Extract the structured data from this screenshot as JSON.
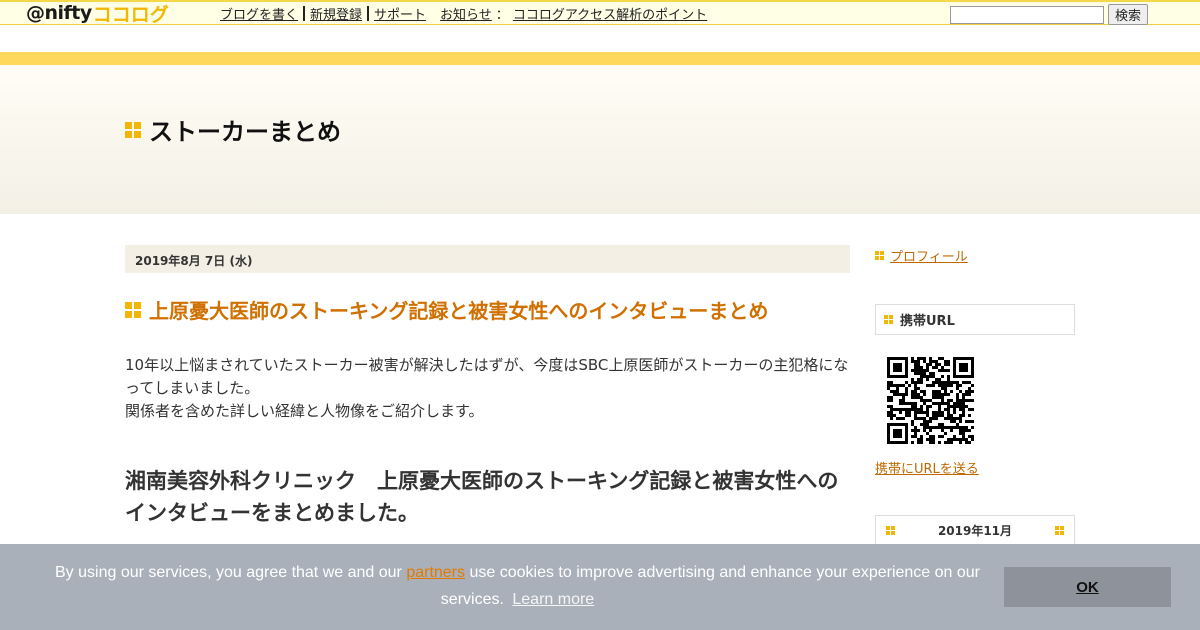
{
  "topbar": {
    "logo_at": "@nifty",
    "logo_cocolog": "ココログ",
    "nav": [
      {
        "label": "ブログを書く"
      },
      {
        "label": "新規登録"
      },
      {
        "label": "サポート"
      }
    ],
    "notice_label": "お知らせ",
    "colon": "：",
    "notice_link": "ココログアクセス解析のポイント",
    "search_button": "検索",
    "search_value": ""
  },
  "header": {
    "blog_title": "ストーカーまとめ"
  },
  "entry": {
    "date": "2019年8月 7日 (水)",
    "title": "上原憂大医師のストーキング記録と被害女性へのインタビューまとめ",
    "body_line1": "10年以上悩まされていたストーカー被害が解決したはずが、今度はSBC上原医師がストーカーの主犯格になってしまいました。",
    "body_line2": "関係者を含めた詳しい経緯と人物像をご紹介します。",
    "heading": "湘南美容外科クリニック　上原憂大医師のストーキング記録と被害女性へのインタビューをまとめました。"
  },
  "sidebar": {
    "profile_link": "プロフィール",
    "mobile_url_title": "携帯URL",
    "mobile_link": "携帯にURLを送る",
    "calendar_title": "2019年11月"
  },
  "cookie": {
    "text_before": "By using our services, you agree that we and our",
    "partners": "partners",
    "text_after": "use cookies to improve advertising and enhance your experience on our services.",
    "learn_more": "Learn more",
    "ok": "OK"
  },
  "colors": {
    "accent_yellow": "#f2b705",
    "link_orange": "#c06a00",
    "title_orange": "#d07000",
    "stripe": "#fdd85d",
    "cookie_bg": "#aab0ba"
  }
}
